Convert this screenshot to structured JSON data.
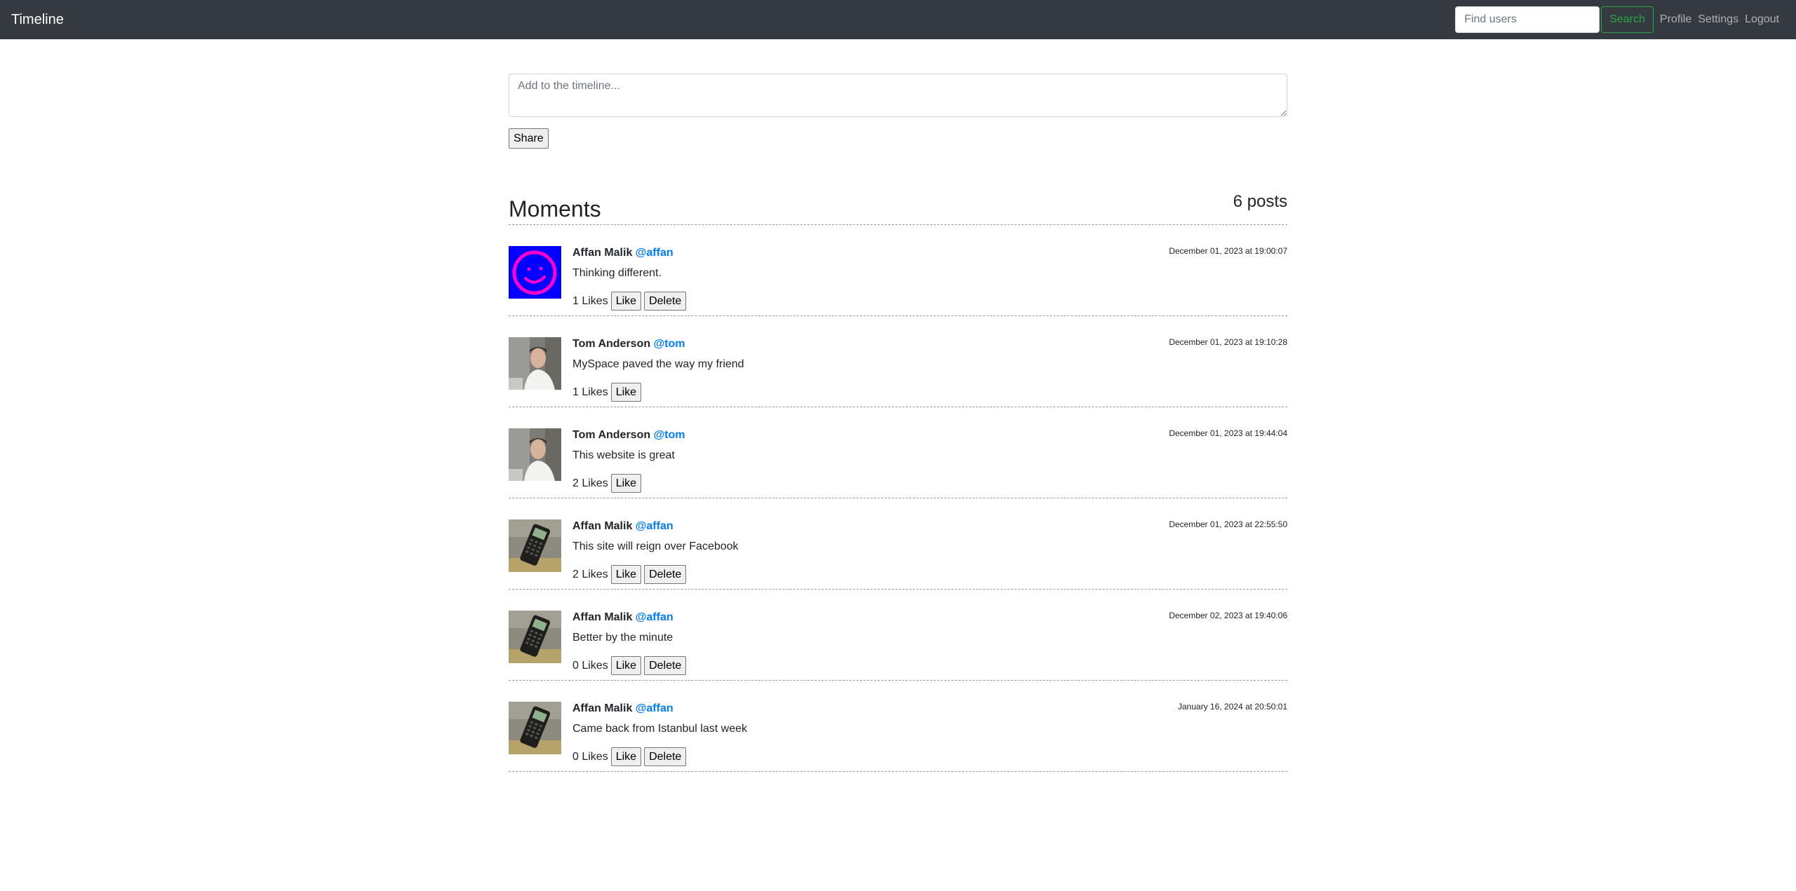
{
  "navbar": {
    "brand": "Timeline",
    "search_placeholder": "Find users",
    "search_button": "Search",
    "links": [
      "Profile",
      "Settings",
      "Logout"
    ]
  },
  "composer": {
    "placeholder": "Add to the timeline...",
    "share_button": "Share"
  },
  "feed": {
    "title": "Moments",
    "count_label": "6 posts"
  },
  "posts": [
    {
      "author": "Affan Malik",
      "handle": "@affan",
      "timestamp": "December 01, 2023 at 19:00:07",
      "content": "Thinking different.",
      "likes": "1 Likes",
      "avatar": "smiley-icon",
      "can_delete": true
    },
    {
      "author": "Tom Anderson",
      "handle": "@tom",
      "timestamp": "December 01, 2023 at 19:10:28",
      "content": "MySpace paved the way my friend",
      "likes": "1 Likes",
      "avatar": "person-photo",
      "can_delete": false
    },
    {
      "author": "Tom Anderson",
      "handle": "@tom",
      "timestamp": "December 01, 2023 at 19:44:04",
      "content": "This website is great",
      "likes": "2 Likes",
      "avatar": "person-photo",
      "can_delete": false
    },
    {
      "author": "Affan Malik",
      "handle": "@affan",
      "timestamp": "December 01, 2023 at 22:55:50",
      "content": "This site will reign over Facebook",
      "likes": "2 Likes",
      "avatar": "calculator-photo",
      "can_delete": true
    },
    {
      "author": "Affan Malik",
      "handle": "@affan",
      "timestamp": "December 02, 2023 at 19:40:06",
      "content": "Better by the minute",
      "likes": "0 Likes",
      "avatar": "calculator-photo",
      "can_delete": true
    },
    {
      "author": "Affan Malik",
      "handle": "@affan",
      "timestamp": "January 16, 2024 at 20:50:01",
      "content": "Came back from Istanbul last week",
      "likes": "0 Likes",
      "avatar": "calculator-photo",
      "can_delete": true
    }
  ],
  "labels": {
    "like_button": "Like",
    "delete_button": "Delete"
  },
  "colors": {
    "navbar_bg": "#343a40",
    "handle_link": "#007bff",
    "search_accent": "#28a745"
  }
}
